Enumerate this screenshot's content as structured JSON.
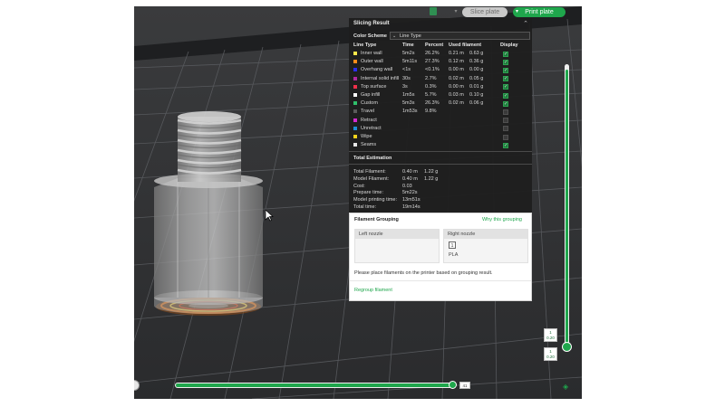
{
  "toolbar": {
    "slice_plate_label": "Slice plate",
    "print_plate_label": "Print plate"
  },
  "slicing_result": {
    "title": "Slicing Result",
    "color_scheme_label": "Color Scheme",
    "color_scheme_value": "Line Type",
    "columns": [
      "Line Type",
      "Time",
      "Percent",
      "Used filament",
      "Display"
    ],
    "rows": [
      {
        "name": "Inner wall",
        "time": "5m2s",
        "percent": "26.2%",
        "length": "0.21 m",
        "weight": "0.63 g",
        "color": "#ffe74a",
        "display": true
      },
      {
        "name": "Outer wall",
        "time": "5m11s",
        "percent": "27.3%",
        "length": "0.12 m",
        "weight": "0.36 g",
        "color": "#ff8c1a",
        "display": true
      },
      {
        "name": "Overhang wall",
        "time": "<1s",
        "percent": "<0.1%",
        "length": "0.00 m",
        "weight": "0.00 g",
        "color": "#2b2ff0",
        "display": true
      },
      {
        "name": "Internal solid infill",
        "time": "30s",
        "percent": "2.7%",
        "length": "0.02 m",
        "weight": "0.05 g",
        "color": "#b02aa0",
        "display": true
      },
      {
        "name": "Top surface",
        "time": "3s",
        "percent": "0.3%",
        "length": "0.00 m",
        "weight": "0.01 g",
        "color": "#f0304a",
        "display": true
      },
      {
        "name": "Gap infill",
        "time": "1m5s",
        "percent": "5.7%",
        "length": "0.03 m",
        "weight": "0.10 g",
        "color": "#ffffff",
        "display": true
      },
      {
        "name": "Custom",
        "time": "5m3s",
        "percent": "26.3%",
        "length": "0.02 m",
        "weight": "0.06 g",
        "color": "#2fbf6a",
        "display": true
      },
      {
        "name": "Travel",
        "time": "1m53s",
        "percent": "9.8%",
        "length": "",
        "weight": "",
        "color": "#5a5a5a",
        "display": false
      },
      {
        "name": "Retract",
        "time": "",
        "percent": "",
        "length": "",
        "weight": "",
        "color": "#d62ad0",
        "display": false
      },
      {
        "name": "Unretract",
        "time": "",
        "percent": "",
        "length": "",
        "weight": "",
        "color": "#1f8fd6",
        "display": false
      },
      {
        "name": "Wipe",
        "time": "",
        "percent": "",
        "length": "",
        "weight": "",
        "color": "#f0d21c",
        "display": false
      },
      {
        "name": "Seams",
        "time": "",
        "percent": "",
        "length": "",
        "weight": "",
        "color": "#e6e6e6",
        "display": true
      }
    ]
  },
  "total_estimation": {
    "title": "Total Estimation",
    "rows": [
      {
        "label": "Total Filament:",
        "v1": "0.40 m",
        "v2": "1.22 g"
      },
      {
        "label": "Model Filament:",
        "v1": "0.40 m",
        "v2": "1.22 g"
      },
      {
        "label": "Cost:",
        "v1": "0.03",
        "v2": ""
      },
      {
        "label": "Prepare time:",
        "v1": "5m22s",
        "v2": ""
      },
      {
        "label": "Model printing time:",
        "v1": "13m51s",
        "v2": ""
      },
      {
        "label": "Total time:",
        "v1": "19m14s",
        "v2": ""
      }
    ]
  },
  "filament_grouping": {
    "title": "Filament Grouping",
    "why_link": "Why this grouping",
    "left_nozzle": "Left nozzle",
    "right_nozzle": "Right nozzle",
    "filament_number": "1",
    "filament_type": "PLA",
    "note": "Please place filaments on the printer based on grouping result.",
    "regroup_link": "Regroup filament"
  },
  "vertical_slider": {
    "top_label_line1": "1",
    "top_label_line2": "0.20",
    "bottom_label_line1": "1",
    "bottom_label_line2": "0.20"
  },
  "horizontal_slider": {
    "label": "41"
  }
}
